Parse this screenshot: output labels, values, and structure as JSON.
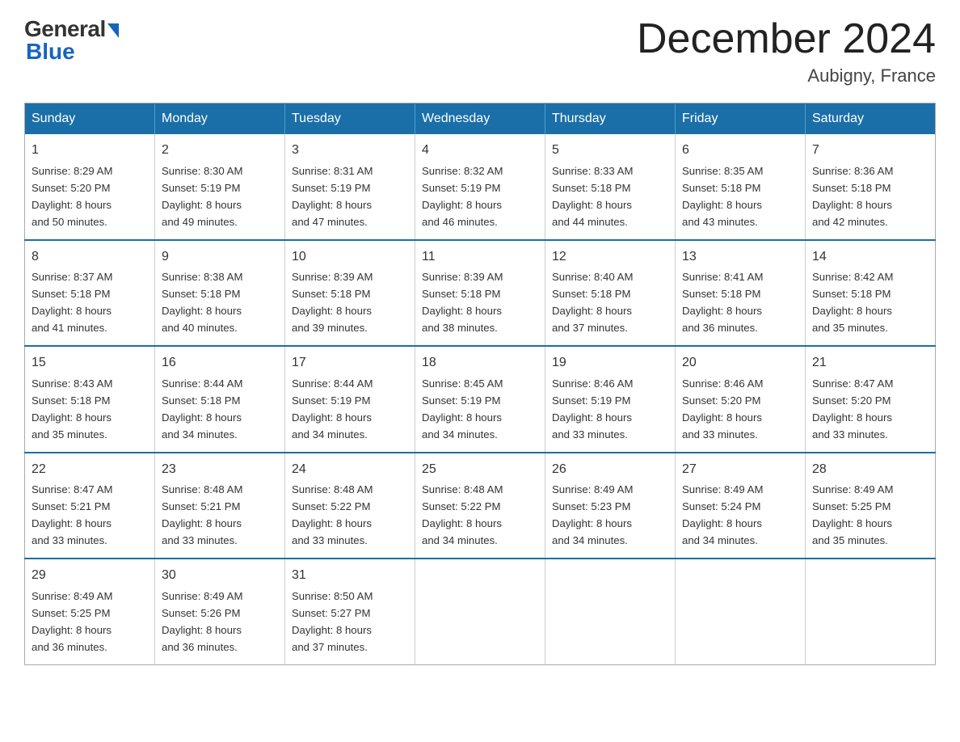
{
  "header": {
    "logo_general": "General",
    "logo_blue": "Blue",
    "month_title": "December 2024",
    "location": "Aubigny, France"
  },
  "days_of_week": [
    "Sunday",
    "Monday",
    "Tuesday",
    "Wednesday",
    "Thursday",
    "Friday",
    "Saturday"
  ],
  "weeks": [
    [
      {
        "day": "1",
        "sunrise": "8:29 AM",
        "sunset": "5:20 PM",
        "daylight": "8 hours and 50 minutes."
      },
      {
        "day": "2",
        "sunrise": "8:30 AM",
        "sunset": "5:19 PM",
        "daylight": "8 hours and 49 minutes."
      },
      {
        "day": "3",
        "sunrise": "8:31 AM",
        "sunset": "5:19 PM",
        "daylight": "8 hours and 47 minutes."
      },
      {
        "day": "4",
        "sunrise": "8:32 AM",
        "sunset": "5:19 PM",
        "daylight": "8 hours and 46 minutes."
      },
      {
        "day": "5",
        "sunrise": "8:33 AM",
        "sunset": "5:18 PM",
        "daylight": "8 hours and 44 minutes."
      },
      {
        "day": "6",
        "sunrise": "8:35 AM",
        "sunset": "5:18 PM",
        "daylight": "8 hours and 43 minutes."
      },
      {
        "day": "7",
        "sunrise": "8:36 AM",
        "sunset": "5:18 PM",
        "daylight": "8 hours and 42 minutes."
      }
    ],
    [
      {
        "day": "8",
        "sunrise": "8:37 AM",
        "sunset": "5:18 PM",
        "daylight": "8 hours and 41 minutes."
      },
      {
        "day": "9",
        "sunrise": "8:38 AM",
        "sunset": "5:18 PM",
        "daylight": "8 hours and 40 minutes."
      },
      {
        "day": "10",
        "sunrise": "8:39 AM",
        "sunset": "5:18 PM",
        "daylight": "8 hours and 39 minutes."
      },
      {
        "day": "11",
        "sunrise": "8:39 AM",
        "sunset": "5:18 PM",
        "daylight": "8 hours and 38 minutes."
      },
      {
        "day": "12",
        "sunrise": "8:40 AM",
        "sunset": "5:18 PM",
        "daylight": "8 hours and 37 minutes."
      },
      {
        "day": "13",
        "sunrise": "8:41 AM",
        "sunset": "5:18 PM",
        "daylight": "8 hours and 36 minutes."
      },
      {
        "day": "14",
        "sunrise": "8:42 AM",
        "sunset": "5:18 PM",
        "daylight": "8 hours and 35 minutes."
      }
    ],
    [
      {
        "day": "15",
        "sunrise": "8:43 AM",
        "sunset": "5:18 PM",
        "daylight": "8 hours and 35 minutes."
      },
      {
        "day": "16",
        "sunrise": "8:44 AM",
        "sunset": "5:18 PM",
        "daylight": "8 hours and 34 minutes."
      },
      {
        "day": "17",
        "sunrise": "8:44 AM",
        "sunset": "5:19 PM",
        "daylight": "8 hours and 34 minutes."
      },
      {
        "day": "18",
        "sunrise": "8:45 AM",
        "sunset": "5:19 PM",
        "daylight": "8 hours and 34 minutes."
      },
      {
        "day": "19",
        "sunrise": "8:46 AM",
        "sunset": "5:19 PM",
        "daylight": "8 hours and 33 minutes."
      },
      {
        "day": "20",
        "sunrise": "8:46 AM",
        "sunset": "5:20 PM",
        "daylight": "8 hours and 33 minutes."
      },
      {
        "day": "21",
        "sunrise": "8:47 AM",
        "sunset": "5:20 PM",
        "daylight": "8 hours and 33 minutes."
      }
    ],
    [
      {
        "day": "22",
        "sunrise": "8:47 AM",
        "sunset": "5:21 PM",
        "daylight": "8 hours and 33 minutes."
      },
      {
        "day": "23",
        "sunrise": "8:48 AM",
        "sunset": "5:21 PM",
        "daylight": "8 hours and 33 minutes."
      },
      {
        "day": "24",
        "sunrise": "8:48 AM",
        "sunset": "5:22 PM",
        "daylight": "8 hours and 33 minutes."
      },
      {
        "day": "25",
        "sunrise": "8:48 AM",
        "sunset": "5:22 PM",
        "daylight": "8 hours and 34 minutes."
      },
      {
        "day": "26",
        "sunrise": "8:49 AM",
        "sunset": "5:23 PM",
        "daylight": "8 hours and 34 minutes."
      },
      {
        "day": "27",
        "sunrise": "8:49 AM",
        "sunset": "5:24 PM",
        "daylight": "8 hours and 34 minutes."
      },
      {
        "day": "28",
        "sunrise": "8:49 AM",
        "sunset": "5:25 PM",
        "daylight": "8 hours and 35 minutes."
      }
    ],
    [
      {
        "day": "29",
        "sunrise": "8:49 AM",
        "sunset": "5:25 PM",
        "daylight": "8 hours and 36 minutes."
      },
      {
        "day": "30",
        "sunrise": "8:49 AM",
        "sunset": "5:26 PM",
        "daylight": "8 hours and 36 minutes."
      },
      {
        "day": "31",
        "sunrise": "8:50 AM",
        "sunset": "5:27 PM",
        "daylight": "8 hours and 37 minutes."
      },
      null,
      null,
      null,
      null
    ]
  ],
  "labels": {
    "sunrise": "Sunrise:",
    "sunset": "Sunset:",
    "daylight": "Daylight:"
  }
}
